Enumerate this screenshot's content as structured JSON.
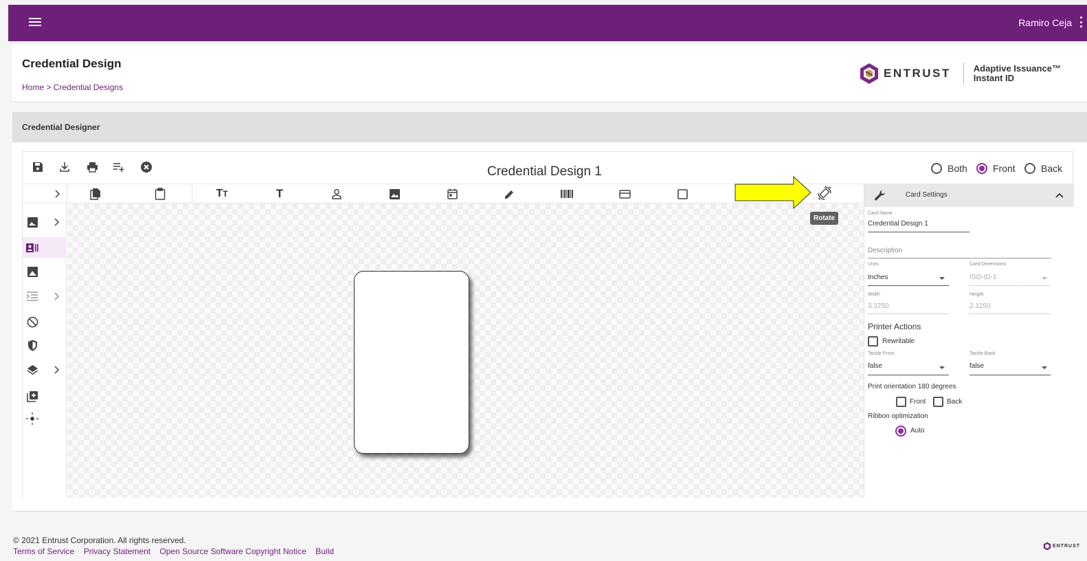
{
  "topbar": {
    "username": "Ramiro Ceja"
  },
  "header": {
    "title": "Credential Design",
    "breadcrumb": "Home > Credential Designs",
    "brand": "ENTRUST",
    "product_line1": "Adaptive Issuance™",
    "product_line2": "Instant ID"
  },
  "section": {
    "title": "Credential Designer"
  },
  "designer": {
    "design_name": "Credential Design 1",
    "sides": [
      {
        "label": "Both",
        "selected": false
      },
      {
        "label": "Front",
        "selected": true
      },
      {
        "label": "Back",
        "selected": false
      }
    ],
    "toolbar_icons": [
      "save-icon",
      "download-icon",
      "print-icon",
      "playlist-add-icon",
      "cancel-icon"
    ],
    "element_icons": [
      "copy-icon",
      "paste-icon",
      "text-size-icon",
      "text-icon",
      "person-icon",
      "image-icon",
      "calendar-icon",
      "pencil-icon",
      "barcode-icon",
      "credit-card-icon",
      "rectangle-icon",
      "rotate-icon"
    ],
    "rail_icons": [
      "background-image-icon",
      "id-card-icon",
      "image-icon",
      "indent-list-icon",
      "block-icon",
      "security-shield-icon",
      "layers-icon",
      "add-box-icon",
      "crosshair-icon"
    ],
    "tooltip": "Rotate",
    "highlight_color": "#ffff00",
    "accent_color": "#8e2d9a"
  },
  "card_settings": {
    "title": "Card Settings",
    "card_name_label": "Card Name",
    "card_name": "Credential Design 1",
    "description_placeholder": "Description",
    "units_label": "Units",
    "units": "Inches",
    "dimensions_label": "Card Dimensions",
    "dimensions": "ISO-ID-1",
    "width_label": "Width",
    "width": "3.3750",
    "height_label": "Height",
    "height": "2.1250",
    "printer_actions": "Printer Actions",
    "rewritable": "Rewritable",
    "tactile_front_label": "Tactile Front",
    "tactile_front": "false",
    "tactile_back_label": "Tactile Back",
    "tactile_back": "false",
    "print_orientation": "Print orientation 180 degrees",
    "orientation_front": "Front",
    "orientation_back": "Back",
    "ribbon_optimization": "Ribbon optimization",
    "ribbon_auto": "Auto"
  },
  "footer": {
    "copyright": "© 2021 Entrust Corporation. All rights reserved.",
    "links": [
      "Terms of Service",
      "Privacy Statement",
      "Open Source Software Copyright Notice",
      "Build"
    ],
    "brand": "ENTRUST"
  },
  "colors": {
    "primary": "#6d1f79",
    "accent": "#8e2d9a"
  }
}
